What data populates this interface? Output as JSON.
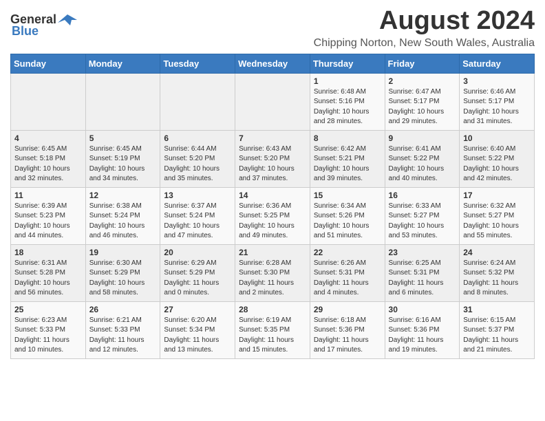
{
  "logo": {
    "general": "General",
    "blue": "Blue"
  },
  "title": "August 2024",
  "subtitle": "Chipping Norton, New South Wales, Australia",
  "days_of_week": [
    "Sunday",
    "Monday",
    "Tuesday",
    "Wednesday",
    "Thursday",
    "Friday",
    "Saturday"
  ],
  "weeks": [
    [
      {
        "num": "",
        "info": ""
      },
      {
        "num": "",
        "info": ""
      },
      {
        "num": "",
        "info": ""
      },
      {
        "num": "",
        "info": ""
      },
      {
        "num": "1",
        "info": "Sunrise: 6:48 AM\nSunset: 5:16 PM\nDaylight: 10 hours\nand 28 minutes."
      },
      {
        "num": "2",
        "info": "Sunrise: 6:47 AM\nSunset: 5:17 PM\nDaylight: 10 hours\nand 29 minutes."
      },
      {
        "num": "3",
        "info": "Sunrise: 6:46 AM\nSunset: 5:17 PM\nDaylight: 10 hours\nand 31 minutes."
      }
    ],
    [
      {
        "num": "4",
        "info": "Sunrise: 6:45 AM\nSunset: 5:18 PM\nDaylight: 10 hours\nand 32 minutes."
      },
      {
        "num": "5",
        "info": "Sunrise: 6:45 AM\nSunset: 5:19 PM\nDaylight: 10 hours\nand 34 minutes."
      },
      {
        "num": "6",
        "info": "Sunrise: 6:44 AM\nSunset: 5:20 PM\nDaylight: 10 hours\nand 35 minutes."
      },
      {
        "num": "7",
        "info": "Sunrise: 6:43 AM\nSunset: 5:20 PM\nDaylight: 10 hours\nand 37 minutes."
      },
      {
        "num": "8",
        "info": "Sunrise: 6:42 AM\nSunset: 5:21 PM\nDaylight: 10 hours\nand 39 minutes."
      },
      {
        "num": "9",
        "info": "Sunrise: 6:41 AM\nSunset: 5:22 PM\nDaylight: 10 hours\nand 40 minutes."
      },
      {
        "num": "10",
        "info": "Sunrise: 6:40 AM\nSunset: 5:22 PM\nDaylight: 10 hours\nand 42 minutes."
      }
    ],
    [
      {
        "num": "11",
        "info": "Sunrise: 6:39 AM\nSunset: 5:23 PM\nDaylight: 10 hours\nand 44 minutes."
      },
      {
        "num": "12",
        "info": "Sunrise: 6:38 AM\nSunset: 5:24 PM\nDaylight: 10 hours\nand 46 minutes."
      },
      {
        "num": "13",
        "info": "Sunrise: 6:37 AM\nSunset: 5:24 PM\nDaylight: 10 hours\nand 47 minutes."
      },
      {
        "num": "14",
        "info": "Sunrise: 6:36 AM\nSunset: 5:25 PM\nDaylight: 10 hours\nand 49 minutes."
      },
      {
        "num": "15",
        "info": "Sunrise: 6:34 AM\nSunset: 5:26 PM\nDaylight: 10 hours\nand 51 minutes."
      },
      {
        "num": "16",
        "info": "Sunrise: 6:33 AM\nSunset: 5:27 PM\nDaylight: 10 hours\nand 53 minutes."
      },
      {
        "num": "17",
        "info": "Sunrise: 6:32 AM\nSunset: 5:27 PM\nDaylight: 10 hours\nand 55 minutes."
      }
    ],
    [
      {
        "num": "18",
        "info": "Sunrise: 6:31 AM\nSunset: 5:28 PM\nDaylight: 10 hours\nand 56 minutes."
      },
      {
        "num": "19",
        "info": "Sunrise: 6:30 AM\nSunset: 5:29 PM\nDaylight: 10 hours\nand 58 minutes."
      },
      {
        "num": "20",
        "info": "Sunrise: 6:29 AM\nSunset: 5:29 PM\nDaylight: 11 hours\nand 0 minutes."
      },
      {
        "num": "21",
        "info": "Sunrise: 6:28 AM\nSunset: 5:30 PM\nDaylight: 11 hours\nand 2 minutes."
      },
      {
        "num": "22",
        "info": "Sunrise: 6:26 AM\nSunset: 5:31 PM\nDaylight: 11 hours\nand 4 minutes."
      },
      {
        "num": "23",
        "info": "Sunrise: 6:25 AM\nSunset: 5:31 PM\nDaylight: 11 hours\nand 6 minutes."
      },
      {
        "num": "24",
        "info": "Sunrise: 6:24 AM\nSunset: 5:32 PM\nDaylight: 11 hours\nand 8 minutes."
      }
    ],
    [
      {
        "num": "25",
        "info": "Sunrise: 6:23 AM\nSunset: 5:33 PM\nDaylight: 11 hours\nand 10 minutes."
      },
      {
        "num": "26",
        "info": "Sunrise: 6:21 AM\nSunset: 5:33 PM\nDaylight: 11 hours\nand 12 minutes."
      },
      {
        "num": "27",
        "info": "Sunrise: 6:20 AM\nSunset: 5:34 PM\nDaylight: 11 hours\nand 13 minutes."
      },
      {
        "num": "28",
        "info": "Sunrise: 6:19 AM\nSunset: 5:35 PM\nDaylight: 11 hours\nand 15 minutes."
      },
      {
        "num": "29",
        "info": "Sunrise: 6:18 AM\nSunset: 5:36 PM\nDaylight: 11 hours\nand 17 minutes."
      },
      {
        "num": "30",
        "info": "Sunrise: 6:16 AM\nSunset: 5:36 PM\nDaylight: 11 hours\nand 19 minutes."
      },
      {
        "num": "31",
        "info": "Sunrise: 6:15 AM\nSunset: 5:37 PM\nDaylight: 11 hours\nand 21 minutes."
      }
    ]
  ]
}
